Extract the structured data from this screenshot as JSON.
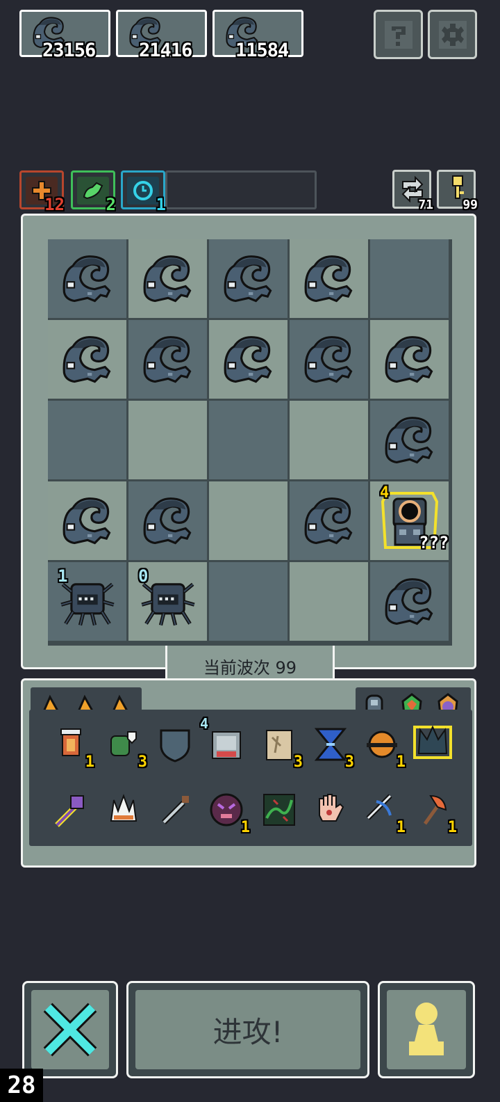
{
  "resources": [
    {
      "value": "23156",
      "border": "#f5d142"
    },
    {
      "value": "21416",
      "border": "#d9e3e6"
    },
    {
      "value": "11584",
      "border": "#e7814c"
    }
  ],
  "buffs": [
    {
      "count": "12",
      "icon": "plus-icon",
      "border": "#b8462d",
      "fill": "#e07a2e",
      "count_color": "#e0402f"
    },
    {
      "count": "2",
      "icon": "leaf-icon",
      "border": "#3fbf5a",
      "fill": "#2d6b3a",
      "count_color": "#59e06b"
    },
    {
      "count": "1",
      "icon": "clock-icon",
      "border": "#2aa7c9",
      "fill": "#1e4b5a",
      "count_color": "#35d2e8"
    }
  ],
  "side_counters": {
    "refresh": "71",
    "key": "99"
  },
  "board_cells": [
    [
      "blob",
      "blob",
      "blob",
      "blob",
      "empty"
    ],
    [
      "blob",
      "blob",
      "blob",
      "blob",
      "blob"
    ],
    [
      "empty",
      "empty",
      "empty",
      "empty",
      "blob"
    ],
    [
      "blob",
      "blob",
      "empty",
      "blob",
      "boss"
    ],
    [
      "spider",
      "spider",
      "empty",
      "empty",
      "blob"
    ]
  ],
  "spider_labels": [
    "1",
    "0"
  ],
  "boss": {
    "level": "4",
    "hp": "???"
  },
  "wave_label": "当前波次 99",
  "inventory_rows": [
    [
      {
        "icon": "lantern-icon",
        "count": "1"
      },
      {
        "icon": "goblin-icon",
        "count": "3"
      },
      {
        "icon": "shield-icon",
        "count": ""
      },
      {
        "icon": "gate-icon",
        "count": "",
        "badge": "4"
      },
      {
        "icon": "scroll-icon",
        "count": "3"
      },
      {
        "icon": "hourglass-icon",
        "count": "3"
      },
      {
        "icon": "orb-icon",
        "count": "1"
      },
      {
        "icon": "crown-icon",
        "count": ""
      }
    ],
    [
      {
        "icon": "staff-icon",
        "count": ""
      },
      {
        "icon": "claw-icon",
        "count": ""
      },
      {
        "icon": "sword-icon",
        "count": ""
      },
      {
        "icon": "demon-icon",
        "count": "1"
      },
      {
        "icon": "vine-icon",
        "count": ""
      },
      {
        "icon": "palm-icon",
        "count": ""
      },
      {
        "icon": "crossbow-icon",
        "count": "1"
      },
      {
        "icon": "axe-icon",
        "count": "1"
      }
    ]
  ],
  "attack_label": "进攻!",
  "fps": "28"
}
